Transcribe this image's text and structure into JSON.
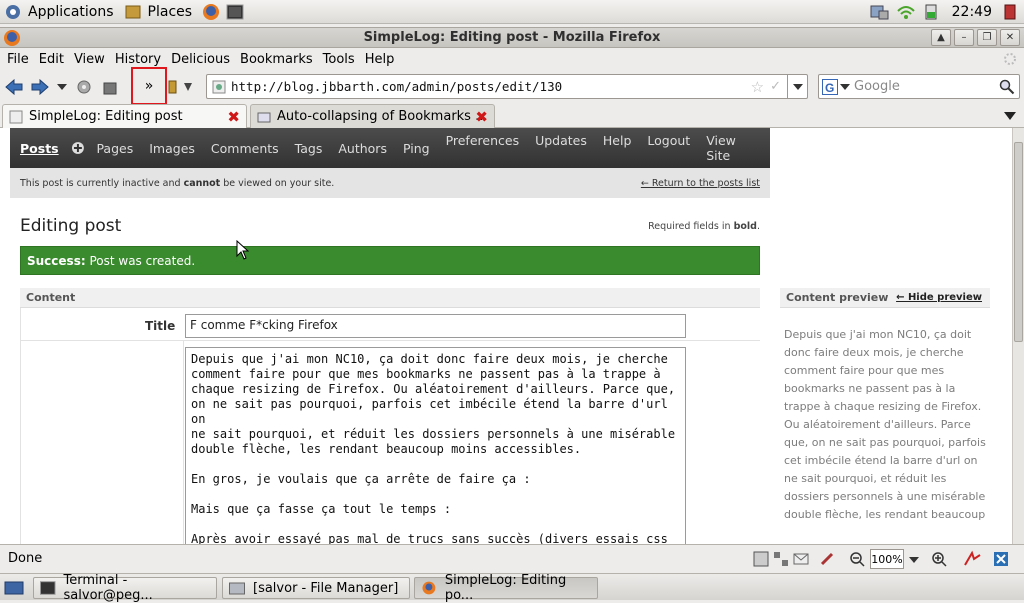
{
  "top_panel": {
    "applications_label": "Applications",
    "places_label": "Places",
    "clock": "22:49"
  },
  "window": {
    "title": "SimpleLog: Editing post - Mozilla Firefox"
  },
  "menubar": {
    "items": [
      {
        "label": "File",
        "accel": "F"
      },
      {
        "label": "Edit"
      },
      {
        "label": "View"
      },
      {
        "label": "History"
      },
      {
        "label": "Delicious"
      },
      {
        "label": "Bookmarks"
      },
      {
        "label": "Tools"
      },
      {
        "label": "Help"
      }
    ]
  },
  "navbar": {
    "overflow_chevron": "»",
    "url": "http://blog.jbbarth.com/admin/posts/edit/130",
    "search_placeholder": "Google"
  },
  "tabs": [
    {
      "label": "SimpleLog: Editing post",
      "active": true
    },
    {
      "label": "Auto-collapsing of Bookmarks ...",
      "active": false
    }
  ],
  "page": {
    "nav_left": [
      "Posts",
      "Pages",
      "Images",
      "Comments",
      "Tags",
      "Authors",
      "Ping"
    ],
    "nav_right": [
      "Preferences",
      "Updates",
      "Help",
      "Logout",
      "View Site"
    ],
    "notice_text_pre": "This post is currently inactive and ",
    "notice_text_bold": "cannot",
    "notice_text_post": " be viewed on your site.",
    "return_link": "← Return to the posts list",
    "heading": "Editing post",
    "required_pre": "Required fields in ",
    "required_bold": "bold",
    "required_post": ".",
    "success_bold": "Success:",
    "success_text": " Post was created.",
    "section_content": "Content",
    "title_label": "Title",
    "title_value": "F comme F*cking Firefox",
    "body_text": "Depuis que j'ai mon NC10, ça doit donc faire deux mois, je cherche\ncomment faire pour que mes bookmarks ne passent pas à la trappe à\nchaque resizing de Firefox. Ou aléatoirement d'ailleurs. Parce que,\non ne sait pas pourquoi, parfois cet imbécile étend la barre d'url on\nne sait pourquoi, et réduit les dossiers personnels à une misérable\ndouble flèche, les rendant beaucoup moins accessibles.\n\nEn gros, je voulais que ça arrête de faire ça :\n\nMais que ça fasse ça tout le temps :\n\nAprès avoir essayé pas mal de trucs sans succès (divers essais css\nsous stylish et compagnie), j'ai trouvé l'inspiration",
    "preview_header": "Content preview",
    "hide_preview": "← Hide preview",
    "preview_text": "Depuis que j'ai mon NC10, ça doit donc faire deux mois, je cherche comment faire pour que mes bookmarks ne passent pas à la trappe à chaque resizing de Firefox. Ou aléatoirement d'ailleurs. Parce que, on ne sait pas pourquoi, parfois cet imbécile étend la barre d'url on ne sait pourquoi, et réduit les dossiers personnels à une misérable double flèche, les rendant beaucoup"
  },
  "statusbar": {
    "status": "Done",
    "zoom": "100%"
  },
  "taskbar": {
    "items": [
      {
        "label": "Terminal - salvor@peg..."
      },
      {
        "label": "[salvor - File Manager]"
      },
      {
        "label": "SimpleLog: Editing po..."
      }
    ]
  }
}
